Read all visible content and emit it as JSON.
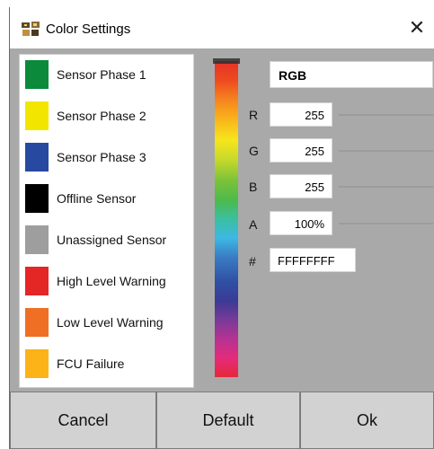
{
  "window": {
    "title": "Color Settings",
    "close_glyph": "✕"
  },
  "legend": [
    {
      "label": "Sensor Phase 1",
      "color": "#0a8a3a"
    },
    {
      "label": "Sensor Phase 2",
      "color": "#f2e600"
    },
    {
      "label": "Sensor Phase 3",
      "color": "#274aa0"
    },
    {
      "label": "Offline Sensor",
      "color": "#000000"
    },
    {
      "label": "Unassigned Sensor",
      "color": "#9e9e9e"
    },
    {
      "label": "High Level Warning",
      "color": "#e42625"
    },
    {
      "label": "Low Level Warning",
      "color": "#ef6f24"
    },
    {
      "label": "FCU Failure",
      "color": "#fcb317"
    }
  ],
  "picker": {
    "mode": "RGB",
    "channels": [
      {
        "label": "R",
        "value": "255"
      },
      {
        "label": "G",
        "value": "255"
      },
      {
        "label": "B",
        "value": "255"
      },
      {
        "label": "A",
        "value": "100%"
      }
    ],
    "hex_label": "#",
    "hex_value": "FFFFFFFF"
  },
  "buttons": {
    "cancel": "Cancel",
    "default": "Default",
    "ok": "Ok"
  }
}
